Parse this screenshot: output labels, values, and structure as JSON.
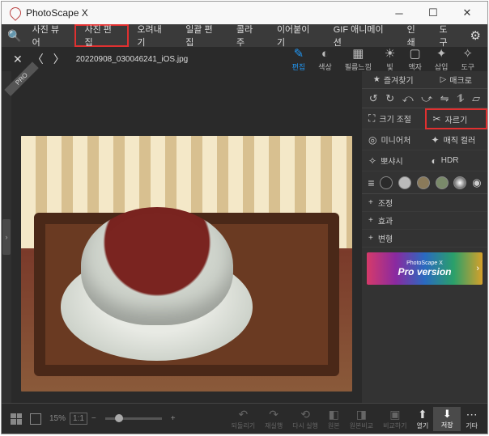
{
  "app": {
    "title": "PhotoScape X"
  },
  "tabs": {
    "items": [
      {
        "label": "사진 뷰어"
      },
      {
        "label": "사진 편집"
      },
      {
        "label": "오려내기"
      },
      {
        "label": "일괄 편집"
      },
      {
        "label": "콜라주"
      },
      {
        "label": "이어붙이기"
      },
      {
        "label": "GIF 애니메이션"
      },
      {
        "label": "인쇄"
      },
      {
        "label": "도구"
      }
    ]
  },
  "file": {
    "name": "20220908_030046241_iOS.jpg"
  },
  "toolbar": {
    "edit": "편집",
    "color": "색상",
    "film": "필름느낌",
    "light": "빛",
    "frame": "액자",
    "insert": "삽입",
    "tools": "도구"
  },
  "panel": {
    "favorites": "즐겨찾기",
    "macro": "매크로",
    "resize": "크기 조절",
    "crop": "자르기",
    "miniature": "미니어처",
    "magic_color": "매직 컬러",
    "vignette": "뽀샤시",
    "hdr": "HDR",
    "adjust": "조정",
    "effect": "효과",
    "transform": "변형"
  },
  "promo": {
    "brand": "PhotoScape X",
    "line": "Pro version"
  },
  "bottom": {
    "zoom": "15%",
    "onetoone": "1:1",
    "undo": "되돌리기",
    "redo": "재실행",
    "undoall": "다시 실행",
    "original": "원본",
    "compare": "원본비교",
    "before": "비교하기",
    "open": "열기",
    "save": "저장",
    "etc": "기타"
  },
  "badge": {
    "pro": "PRO"
  }
}
